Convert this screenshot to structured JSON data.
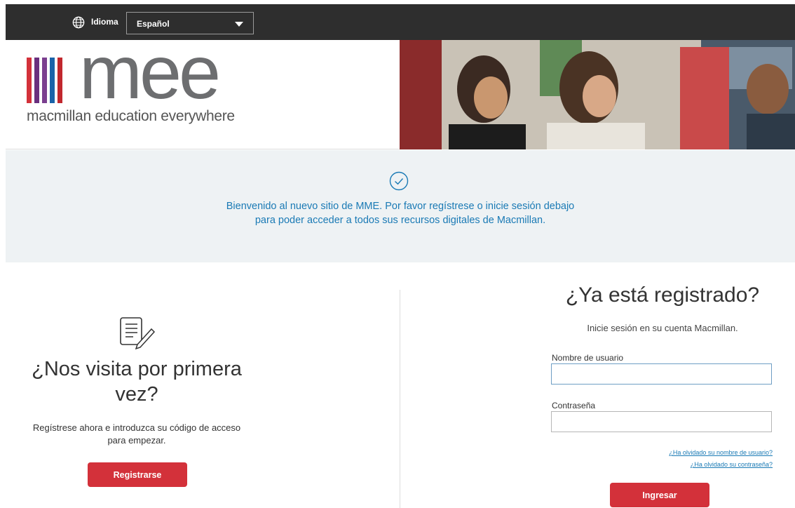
{
  "topbar": {
    "language_icon": "globe-icon",
    "language_label": "Idioma",
    "language_selected": "Español"
  },
  "header": {
    "logo_text": "mee",
    "tagline": "macmillan education everywhere",
    "bar_colors": [
      "#d3313a",
      "#6a2f7e",
      "#6a2f7e",
      "#1a63a9",
      "#c1272d"
    ]
  },
  "banner": {
    "icon": "check-circle-icon",
    "message": "Bienvenido al nuevo sitio de MME. Por favor regístrese o inicie sesión debajo para poder acceder a todos sus recursos digitales de Macmillan."
  },
  "register": {
    "icon": "document-edit-icon",
    "title": "¿Nos visita por primera vez?",
    "description": "Regístrese ahora e introduzca su código de acceso para empezar.",
    "button_label": "Registrarse"
  },
  "login": {
    "title": "¿Ya está registrado?",
    "subtitle": "Inicie sesión en su cuenta Macmillan.",
    "username_label": "Nombre de usuario",
    "username_value": "",
    "password_label": "Contraseña",
    "password_value": "",
    "forgot_username": "¿Ha olvidado su nombre de usuario?",
    "forgot_password": "¿Ha olvidado su contraseña?",
    "button_label": "Ingresar"
  },
  "colors": {
    "accent_red": "#d3313a",
    "link_blue": "#1a7ab5",
    "topbar": "#2e2e2e",
    "banner_bg": "#eef2f4"
  }
}
